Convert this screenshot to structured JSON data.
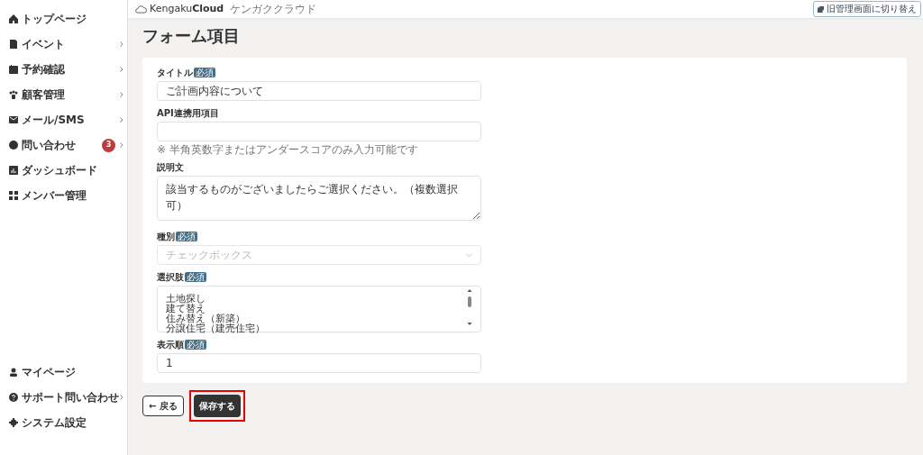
{
  "sidebar": {
    "top_items": [
      {
        "label": "トップページ",
        "submenu": false
      },
      {
        "label": "イベント",
        "submenu": true
      },
      {
        "label": "予約確認",
        "submenu": true
      },
      {
        "label": "顧客管理",
        "submenu": true
      },
      {
        "label": "メール/SMS",
        "submenu": true
      },
      {
        "label": "問い合わせ",
        "submenu": true,
        "badge": "3"
      },
      {
        "label": "ダッシュボード",
        "submenu": false
      },
      {
        "label": "メンバー管理",
        "submenu": false
      }
    ],
    "bottom_items": [
      {
        "label": "マイページ",
        "submenu": false
      },
      {
        "label": "サポート問い合わせ",
        "submenu": true
      },
      {
        "label": "システム設定",
        "submenu": false
      }
    ]
  },
  "header": {
    "logo_text": "Kengaku",
    "logo_bold": "Cloud",
    "logo_sub": "ケンガククラウド",
    "switch_button": "旧管理画面に切り替え"
  },
  "page_title": "フォーム項目",
  "fields": [
    {
      "kind": "input",
      "label": "タイトル",
      "required_badge": "必須",
      "value": "ご計画内容について"
    },
    {
      "kind": "input",
      "label": "API連携用項目",
      "help": "※ 半角英数字またはアンダースコアのみ入力可能です"
    },
    {
      "kind": "textarea",
      "label": "説明文",
      "value": "該当するものがございましたらご選択ください。（複数選択可）"
    },
    {
      "kind": "select",
      "label": "種別",
      "required_badge": "必須",
      "value": "チェックボックス",
      "disabled": true
    },
    {
      "kind": "lines",
      "label": "選択肢",
      "required_badge": "必須",
      "lines": [
        "土地探し",
        "建て替え",
        "住み替え（新築）",
        "分譲住宅（建売住宅）"
      ]
    },
    {
      "kind": "input",
      "label": "表示順",
      "required_badge": "必須",
      "value": "1"
    }
  ],
  "buttons": {
    "back": "← 戻る",
    "save": "保存する"
  }
}
